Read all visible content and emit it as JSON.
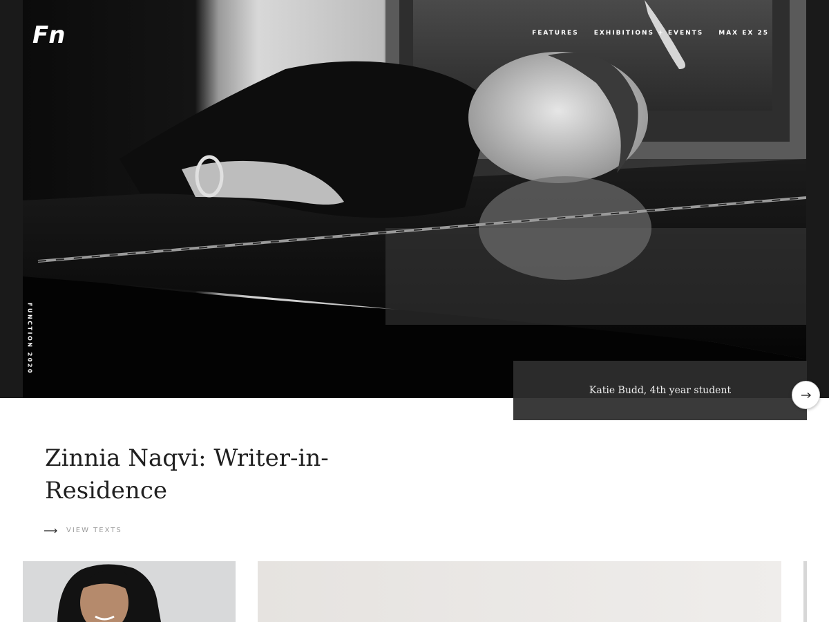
{
  "brand": {
    "logo_text": "Fn"
  },
  "nav": {
    "items": [
      {
        "label": "FEATURES"
      },
      {
        "label": "EXHIBITIONS + EVENTS"
      },
      {
        "label": "MAX EX 25"
      }
    ]
  },
  "hero": {
    "side_label": "FUNCTION 2020",
    "caption": "Katie Budd, 4th year student",
    "next_icon": "arrow-right-icon"
  },
  "article": {
    "title": "Zinnia Naqvi: Writer-in-Residence",
    "link_label": "VIEW TEXTS",
    "link_icon": "long-arrow-right-icon"
  },
  "colors": {
    "hero_bg": "#121212",
    "caption_bg": "#2b2b2b",
    "caption_strip": "#3a3a3a",
    "text_dark": "#1f1f1f",
    "link_gray": "#9a9a9a"
  }
}
